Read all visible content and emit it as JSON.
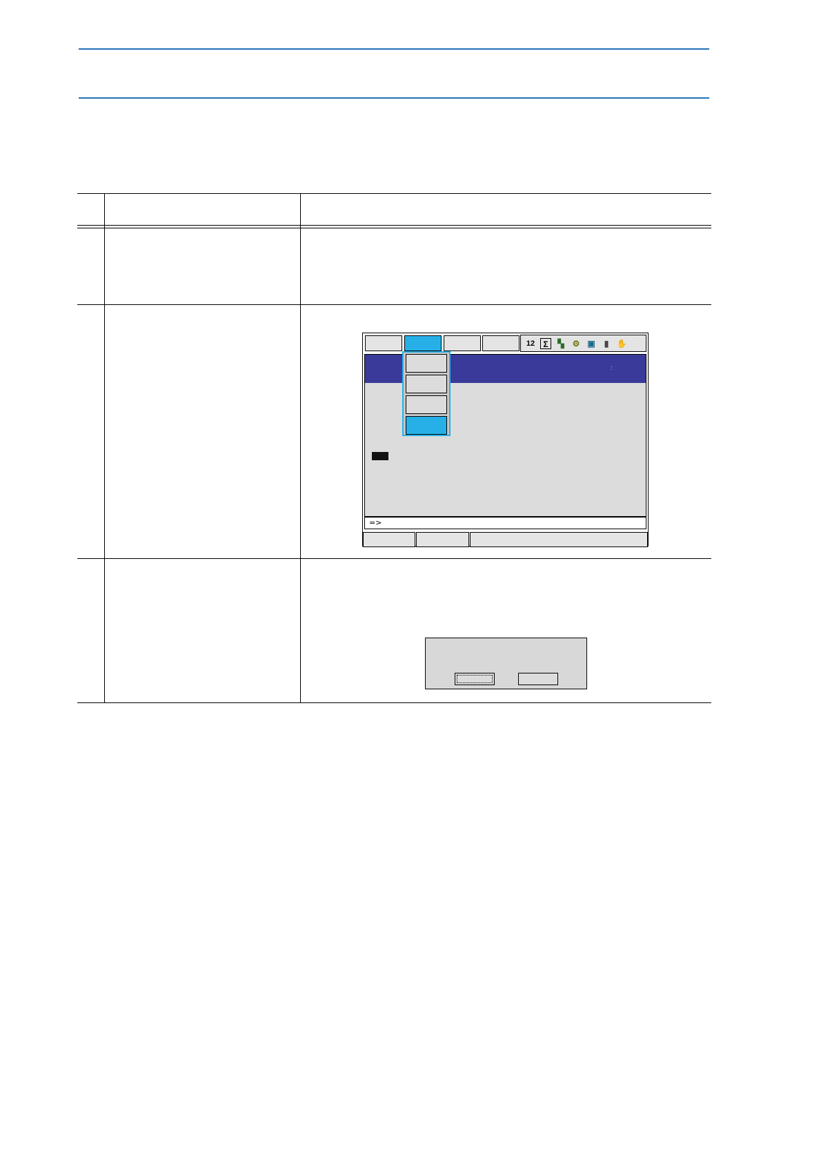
{
  "pendant": {
    "input_prompt": "=>",
    "title_band_mark": ":",
    "status_icons": [
      {
        "name": "tool-number-icon",
        "glyph": "12"
      },
      {
        "name": "sigma-icon",
        "glyph": "Σ"
      },
      {
        "name": "signal-icon",
        "glyph": "▚"
      },
      {
        "name": "robot-icon",
        "glyph": "⚙"
      },
      {
        "name": "cycle-icon",
        "glyph": "▣"
      },
      {
        "name": "storage-icon",
        "glyph": "▮"
      },
      {
        "name": "hand-icon",
        "glyph": "✋"
      }
    ]
  },
  "colors": {
    "rule_blue": "#1f6fb5",
    "title_band": "#3a3a9a",
    "selected": "#27b0e8"
  }
}
